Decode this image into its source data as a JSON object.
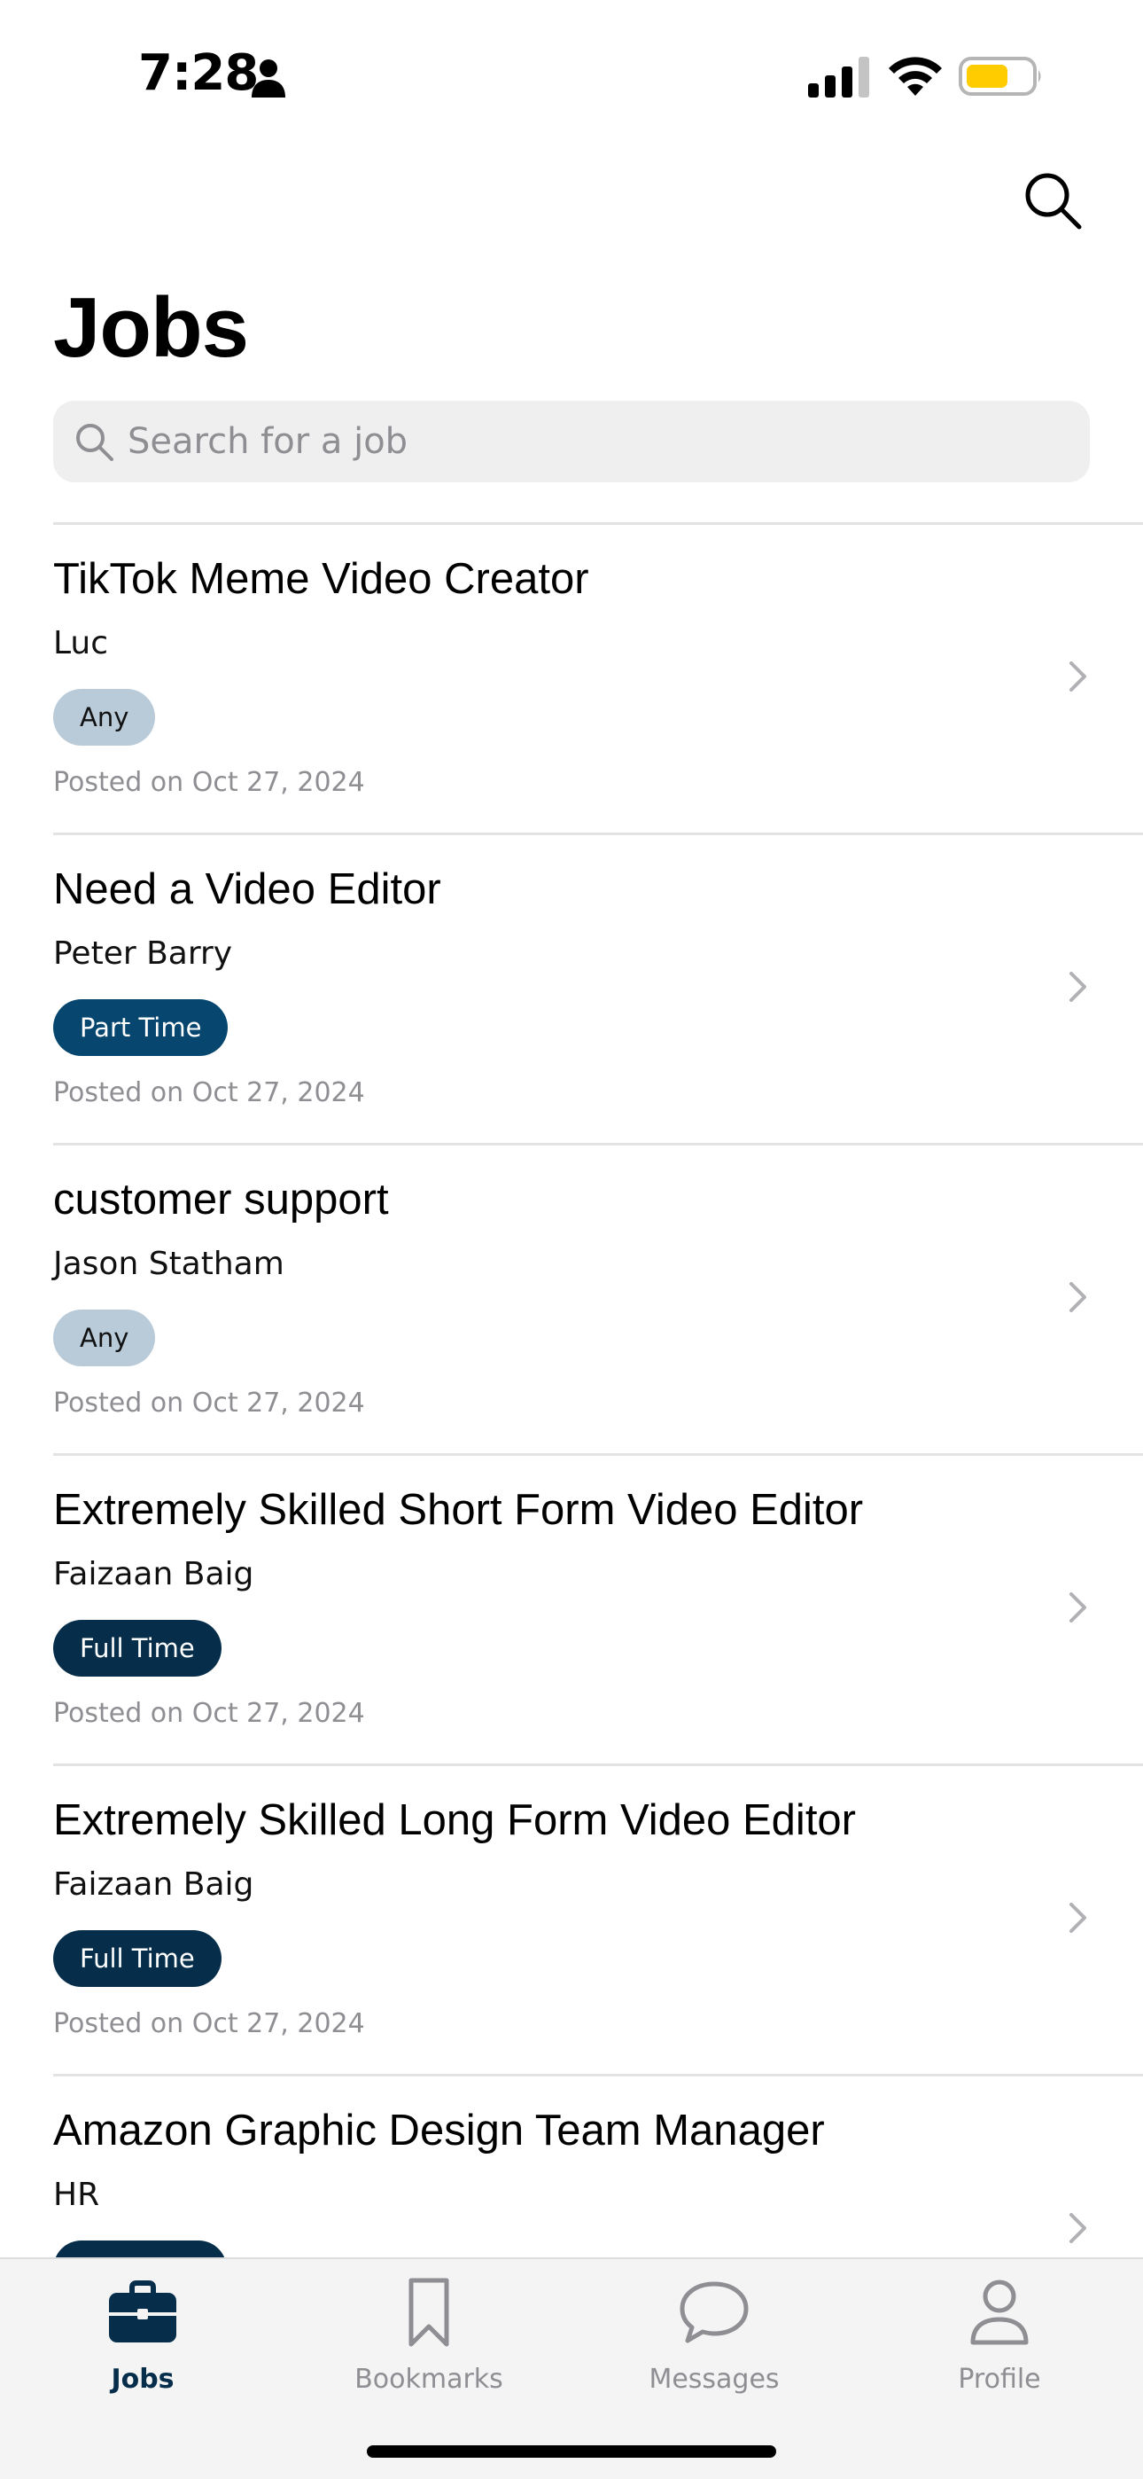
{
  "status_bar": {
    "time": "7:28"
  },
  "header": {
    "title": "Jobs",
    "search_placeholder": "Search for a job"
  },
  "jobs": [
    {
      "title": "TikTok Meme Video Creator",
      "poster": "Luc",
      "type": "Any",
      "posted": "Posted on Oct 27, 2024"
    },
    {
      "title": "Need a Video Editor",
      "poster": "Peter Barry",
      "type": "Part Time",
      "posted": "Posted on Oct 27, 2024"
    },
    {
      "title": "customer support",
      "poster": "Jason Statham",
      "type": "Any",
      "posted": "Posted on Oct 27, 2024"
    },
    {
      "title": "Extremely Skilled Short Form Video Editor",
      "poster": "Faizaan Baig",
      "type": "Full Time",
      "posted": "Posted on Oct 27, 2024"
    },
    {
      "title": "Extremely Skilled Long Form Video Editor",
      "poster": "Faizaan Baig",
      "type": "Full Time",
      "posted": "Posted on Oct 27, 2024"
    },
    {
      "title": "Amazon Graphic Design Team Manager",
      "poster": "HR",
      "type": "",
      "posted": ""
    }
  ],
  "tab_bar": {
    "active": "jobs",
    "tabs": [
      {
        "id": "jobs",
        "label": "Jobs",
        "icon": "briefcase-icon"
      },
      {
        "id": "bookmarks",
        "label": "Bookmarks",
        "icon": "bookmark-icon"
      },
      {
        "id": "messages",
        "label": "Messages",
        "icon": "chat-bubble-icon"
      },
      {
        "id": "profile",
        "label": "Profile",
        "icon": "person-icon"
      }
    ]
  },
  "colors": {
    "badge_any": "#b9cad8",
    "badge_part_time": "#06466f",
    "badge_full_time": "#062d4a",
    "active_tab": "#062d4a",
    "inactive_tab": "#8e8e93",
    "battery_fill": "#ffcc00"
  }
}
